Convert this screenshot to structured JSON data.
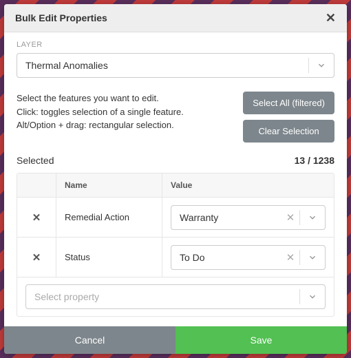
{
  "dialog": {
    "title": "Bulk Edit Properties"
  },
  "layer": {
    "label": "LAYER",
    "value": "Thermal Anomalies"
  },
  "help": {
    "line1": "Select the features you want to edit.",
    "line2": "Click: toggles selection of a single feature.",
    "line3": "Alt/Option + drag: rectangular selection."
  },
  "actions": {
    "select_all": "Select All (filtered)",
    "clear": "Clear Selection"
  },
  "selected": {
    "label": "Selected",
    "count": "13 / 1238"
  },
  "table": {
    "headers": {
      "name": "Name",
      "value": "Value"
    },
    "rows": [
      {
        "name": "Remedial Action",
        "value": "Warranty"
      },
      {
        "name": "Status",
        "value": "To Do"
      }
    ],
    "add_placeholder": "Select property"
  },
  "footer": {
    "cancel": "Cancel",
    "save": "Save"
  }
}
